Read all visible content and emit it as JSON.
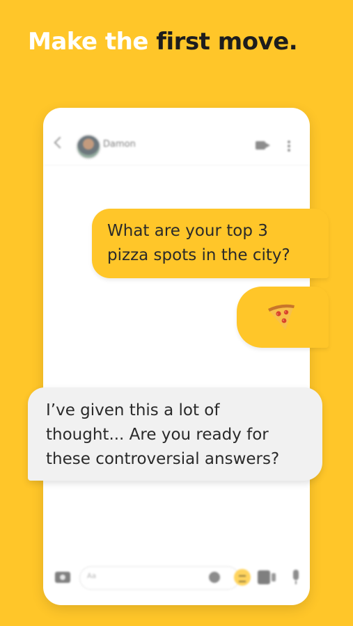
{
  "headline": {
    "light": "Make the",
    "dark": "first move."
  },
  "conversation": {
    "contact_name": "Damon",
    "messages": [
      {
        "from": "me",
        "text_line1": "What are your top 3",
        "text_line2": "pizza spots in the city?"
      },
      {
        "from": "me",
        "emoji": "pizza-icon"
      },
      {
        "from": "them",
        "text_line1": "I’ve given this a lot of",
        "text_line2": "thought... Are you ready for",
        "text_line3": "these controversial answers?"
      }
    ]
  },
  "composer": {
    "placeholder": "Aa"
  },
  "colors": {
    "brand_yellow": "#FFC629",
    "incoming_bubble": "#F1F1F1"
  }
}
